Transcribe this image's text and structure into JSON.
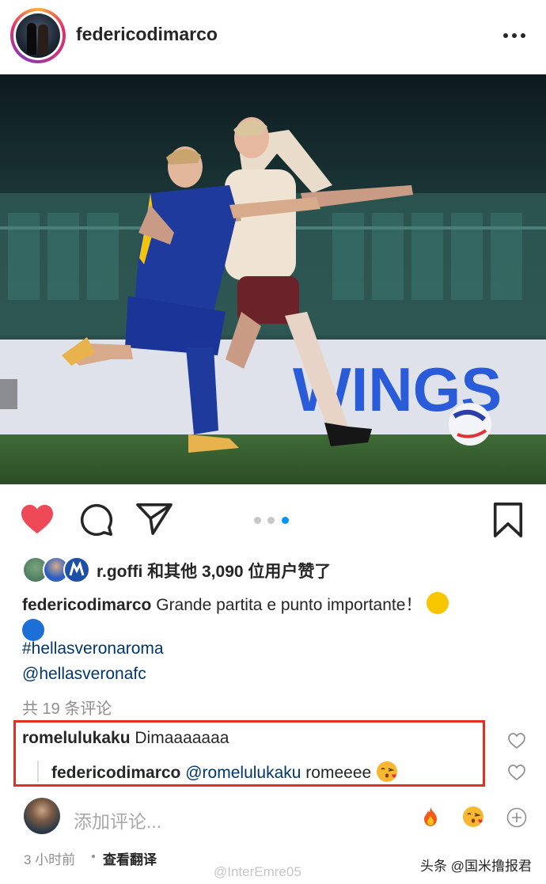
{
  "post": {
    "author": "federicodimarco",
    "photo_description": "Two footballers challenge for the ball in a stadium, one in a blue and yellow Verona kit and one in a white Roma away kit",
    "photo_wordmark": "WINGS",
    "carousel": {
      "count": 3,
      "active_index": 2
    }
  },
  "likes": {
    "user": "r.goffi",
    "text_suffix": "和其他 3,090 位用户赞了"
  },
  "caption": {
    "username": "federicodimarco",
    "text": "Grande partita e punto importante！",
    "hashtag": "#hellasveronaroma",
    "mention": "@hellasveronafc"
  },
  "comments": {
    "count_label": "共 19 条评论",
    "items": [
      {
        "user": "romelulukaku",
        "text": "Dimaaaaaaa"
      },
      {
        "user": "federicodimarco",
        "mention": "@romelulukaku",
        "text": "romeeee"
      }
    ]
  },
  "add_comment": {
    "placeholder": "添加评论..."
  },
  "footer": {
    "time": "3 小时前",
    "translate": "查看翻译"
  },
  "watermarks": {
    "weibo": "@InterEmre05",
    "toutiao": "头条 @国米撸报君"
  },
  "colors": {
    "like_red": "#ed4956",
    "link_blue": "#00376b",
    "highlight_box": "#e0301e",
    "carousel_active": "#0095f6"
  }
}
